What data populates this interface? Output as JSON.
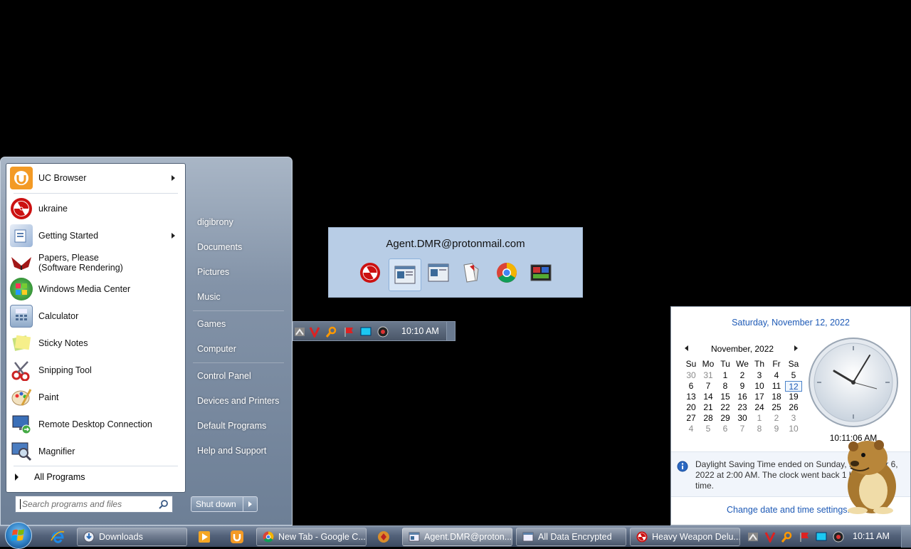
{
  "start_menu": {
    "programs": [
      {
        "label": "UC Browser",
        "icon": "uc-browser-icon",
        "has_submenu": true
      },
      {
        "label": "ukraine",
        "icon": "radiation-icon",
        "has_submenu": false
      },
      {
        "label": "Getting Started",
        "icon": "getting-started-icon",
        "has_submenu": true
      },
      {
        "label": "Papers, Please (Software Rendering)",
        "icon": "papers-please-icon",
        "has_submenu": false
      },
      {
        "label": "Windows Media Center",
        "icon": "media-center-icon",
        "has_submenu": false
      },
      {
        "label": "Calculator",
        "icon": "calculator-icon",
        "has_submenu": false
      },
      {
        "label": "Sticky Notes",
        "icon": "sticky-notes-icon",
        "has_submenu": false
      },
      {
        "label": "Snipping Tool",
        "icon": "scissors-icon",
        "has_submenu": false
      },
      {
        "label": "Paint",
        "icon": "paint-icon",
        "has_submenu": false
      },
      {
        "label": "Remote Desktop Connection",
        "icon": "remote-desktop-icon",
        "has_submenu": false
      },
      {
        "label": "Magnifier",
        "icon": "magnifier-icon",
        "has_submenu": false
      }
    ],
    "all_programs": "All Programs",
    "search_placeholder": "Search programs and files",
    "right_items": [
      "digibrony",
      "Documents",
      "Pictures",
      "Music",
      "Games",
      "Computer",
      "Control Panel",
      "Devices and Printers",
      "Default Programs",
      "Help and Support"
    ],
    "shutdown": "Shut down"
  },
  "thumbnail_popup": {
    "title": "Agent.DMR@protonmail.com",
    "icons": [
      "radiation-icon",
      "window-icon",
      "window-icon",
      "book-icon",
      "chrome-icon",
      "media-icon"
    ]
  },
  "mini_tray": {
    "time": "10:10 AM"
  },
  "calendar": {
    "date_link": "Saturday, November 12, 2022",
    "month": "November, 2022",
    "weekdays": [
      "Su",
      "Mo",
      "Tu",
      "We",
      "Th",
      "Fr",
      "Sa"
    ],
    "weeks": [
      [
        "30",
        "31",
        "1",
        "2",
        "3",
        "4",
        "5"
      ],
      [
        "6",
        "7",
        "8",
        "9",
        "10",
        "11",
        "12"
      ],
      [
        "13",
        "14",
        "15",
        "16",
        "17",
        "18",
        "19"
      ],
      [
        "20",
        "21",
        "22",
        "23",
        "24",
        "25",
        "26"
      ],
      [
        "27",
        "28",
        "29",
        "30",
        "1",
        "2",
        "3"
      ],
      [
        "4",
        "5",
        "6",
        "7",
        "8",
        "9",
        "10"
      ]
    ],
    "today": "12",
    "clock_time": "10:11:06 AM",
    "info": "Daylight Saving Time ended on Sunday, November 6, 2022 at 2:00 AM. The clock went back 1 hour at this time.",
    "settings_link": "Change date and time settings..."
  },
  "taskbar": {
    "buttons": [
      {
        "label": "Downloads",
        "icon": "folder-icon",
        "active": false
      },
      {
        "label": "New Tab - Google C...",
        "icon": "chrome-icon",
        "active": false
      },
      {
        "label": "Agent.DMR@proton...",
        "icon": "window-icon",
        "active": true
      },
      {
        "label": "All Data Encrypted",
        "icon": "window-icon",
        "active": false
      },
      {
        "label": "Heavy Weapon Delu...",
        "icon": "radiation-icon",
        "active": false
      }
    ],
    "time": "10:11 AM"
  }
}
